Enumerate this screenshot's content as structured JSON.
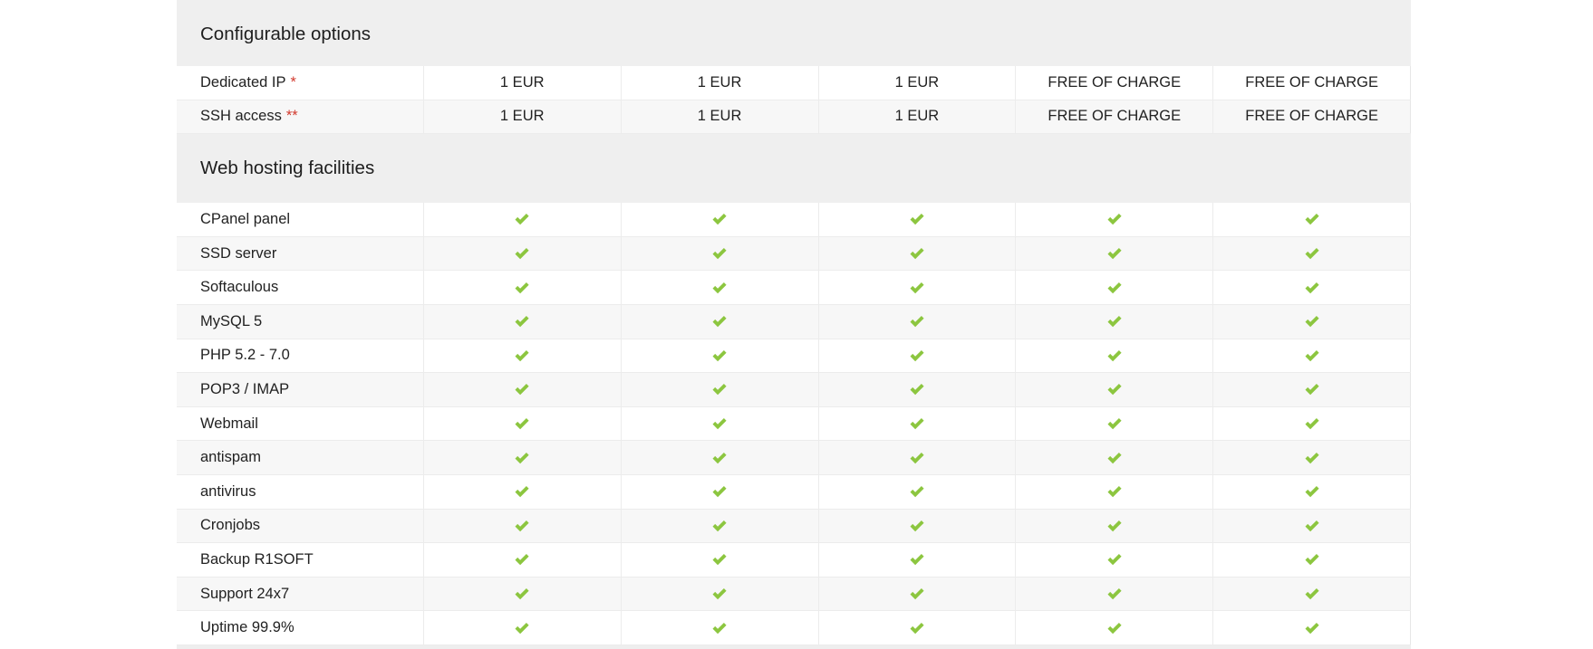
{
  "sections": [
    {
      "title": "Configurable options",
      "rows": [
        {
          "label": "Dedicated IP",
          "marker": "*",
          "values": [
            "1 EUR",
            "1 EUR",
            "1 EUR",
            "FREE OF CHARGE",
            "FREE OF CHARGE"
          ]
        },
        {
          "label": "SSH access",
          "marker": "**",
          "values": [
            "1 EUR",
            "1 EUR",
            "1 EUR",
            "FREE OF CHARGE",
            "FREE OF CHARGE"
          ]
        }
      ]
    },
    {
      "title": "Web hosting facilities",
      "rows": [
        {
          "label": "CPanel panel",
          "icon": "check-icon"
        },
        {
          "label": "SSD server",
          "icon": "check-icon"
        },
        {
          "label": "Softaculous",
          "icon": "check-icon"
        },
        {
          "label": "MySQL 5",
          "icon": "check-icon"
        },
        {
          "label": "PHP 5.2 - 7.0",
          "icon": "check-icon"
        },
        {
          "label": "POP3 / IMAP",
          "icon": "check-icon"
        },
        {
          "label": "Webmail",
          "icon": "check-icon"
        },
        {
          "label": "antispam",
          "icon": "check-icon"
        },
        {
          "label": "antivirus",
          "icon": "check-icon"
        },
        {
          "label": "Cronjobs",
          "icon": "check-icon"
        },
        {
          "label": "Backup R1SOFT",
          "icon": "check-icon"
        },
        {
          "label": "Support 24x7",
          "icon": "check-icon"
        },
        {
          "label": "Uptime 99.9%",
          "icon": "check-icon"
        }
      ]
    }
  ],
  "plan_count": 5,
  "colors": {
    "check": "#8cc63f",
    "required_marker": "#d23a2e",
    "section_bg": "#efefef",
    "stripe_bg": "#f7f7f7"
  }
}
